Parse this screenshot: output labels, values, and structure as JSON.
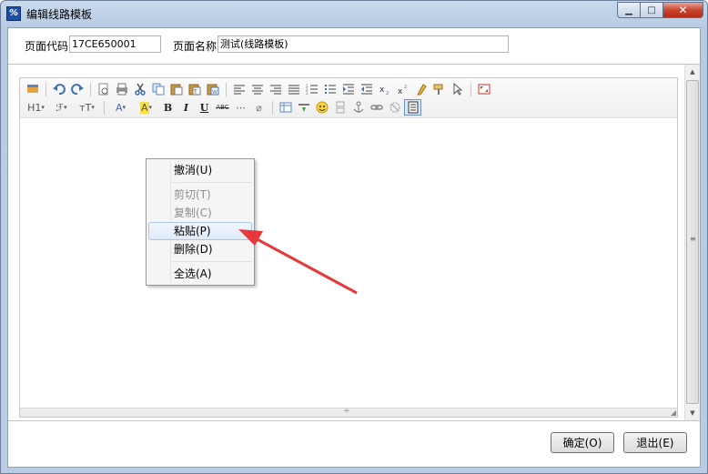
{
  "window": {
    "title": "编辑线路模板",
    "app_icon": "%",
    "minimize": "▁",
    "maximize": "□",
    "close": "✕"
  },
  "fields": {
    "code_label": "页面代码:",
    "code_value": "17CE650001",
    "name_label": "页面名称:",
    "name_value": "测试(线路模板)"
  },
  "toolbar": {
    "row1": [
      "template-icon",
      "undo-icon",
      "redo-icon",
      "preview-icon",
      "print-icon",
      "cut-icon",
      "copy-icon",
      "paste-icon",
      "paste-text-icon",
      "paste-word-icon",
      "align-left-icon",
      "align-center-icon",
      "align-right-icon",
      "justify-icon",
      "ordered-list-icon",
      "unordered-list-icon",
      "indent-icon",
      "outdent-icon",
      "subscript-icon",
      "superscript-icon",
      "clear-format-icon",
      "format-painter-icon",
      "select-all-icon",
      "fullscreen-icon"
    ],
    "heading": "H1",
    "font_family": "ℱ",
    "font_size": "тT",
    "font_color": "A",
    "highlight": "A",
    "bold": "B",
    "italic": "I",
    "underline": "U",
    "strike": "ABC",
    "hr": "⋯",
    "eraser": "⌀"
  },
  "context_menu": {
    "items": [
      {
        "label": "撤消(U)",
        "enabled": true
      },
      {
        "label": "剪切(T)",
        "enabled": false
      },
      {
        "label": "复制(C)",
        "enabled": false
      },
      {
        "label": "粘贴(P)",
        "enabled": true,
        "hover": true
      },
      {
        "label": "删除(D)",
        "enabled": true
      },
      {
        "label": "全选(A)",
        "enabled": true
      }
    ]
  },
  "buttons": {
    "ok": "确定(O)",
    "exit": "退出(E)"
  },
  "colors": {
    "arrow": "#e8393a",
    "menu_hover_border": "#a8c6ee",
    "title_bar": "#b9cce4"
  }
}
